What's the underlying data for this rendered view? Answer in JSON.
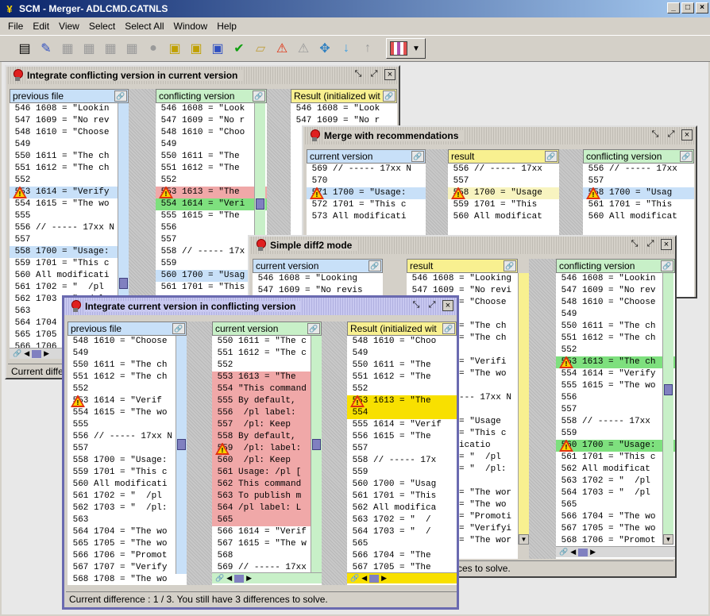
{
  "app": {
    "title": "SCM - Merger- ADLCMD.CATNLS"
  },
  "menu": [
    "File",
    "Edit",
    "View",
    "Select",
    "Select All",
    "Window",
    "Help"
  ],
  "status_text": "Current difference : 1 / 3. You still have 3 differences to solve.",
  "status_short1": "Current differe",
  "status_short2": "ces to solve.",
  "win1": {
    "title": "Integrate conflicting version in current version",
    "h1": "previous file",
    "h2": "conflicting version",
    "h3": "Result (initialized wit",
    "left": [
      [
        "546",
        "1608 = \"Lookin"
      ],
      [
        "547",
        "1609 = \"No rev"
      ],
      [
        "548",
        "1610 = \"Choose"
      ],
      [
        "549",
        ""
      ],
      [
        "550",
        "1611 = \"The ch"
      ],
      [
        "551",
        "1612 = \"The ch"
      ],
      [
        "552",
        ""
      ],
      [
        "553",
        "1614 = \"Verify"
      ],
      [
        "554",
        "1615 = \"The wo"
      ],
      [
        "555",
        ""
      ],
      [
        "556",
        "// ----- 17xx N"
      ],
      [
        "557",
        ""
      ],
      [
        "558",
        "1700 = \"Usage:"
      ],
      [
        "559",
        "1701 = \"This c"
      ],
      [
        "560",
        "All modificati"
      ],
      [
        "561",
        "1702 = \"  /pl"
      ],
      [
        "562",
        "1703 = \"  /pl"
      ],
      [
        "563",
        ""
      ],
      [
        "564",
        "1704"
      ],
      [
        "565",
        "1705"
      ],
      [
        "566",
        "1706"
      ]
    ],
    "mid": [
      [
        "546",
        "1608 = \"Look"
      ],
      [
        "547",
        "1609 = \"No r"
      ],
      [
        "548",
        "1610 = \"Choo"
      ],
      [
        "549",
        ""
      ],
      [
        "550",
        "1611 = \"The"
      ],
      [
        "551",
        "1612 = \"The"
      ],
      [
        "552",
        ""
      ],
      [
        "553",
        "1613 = \"The"
      ],
      [
        "554",
        "1614 = \"Veri"
      ],
      [
        "555",
        "1615 = \"The"
      ],
      [
        "556",
        ""
      ],
      [
        "557",
        ""
      ],
      [
        "558",
        "// ----- 17x"
      ],
      [
        "559",
        ""
      ],
      [
        "560",
        "1700 = \"Usag"
      ],
      [
        "561",
        "1701 = \"This"
      ]
    ],
    "right": [
      [
        "546",
        "1608 = \"Look"
      ],
      [
        "547",
        "1609 = \"No r"
      ]
    ]
  },
  "win2": {
    "title": "Merge with recommendations",
    "h1": "current version",
    "h2": "result",
    "h3": "conflicting version",
    "left": [
      [
        "569",
        "// ----- 17xx N"
      ],
      [
        "570",
        ""
      ],
      [
        "571",
        "1700 = \"Usage:"
      ],
      [
        "572",
        "1701 = \"This c"
      ],
      [
        "573",
        "All modificati"
      ]
    ],
    "mid": [
      [
        "556",
        "// ----- 17xx"
      ],
      [
        "557",
        ""
      ],
      [
        "558",
        "1700 = \"Usage"
      ],
      [
        "559",
        "1701 = \"This"
      ],
      [
        "560",
        "All modificat"
      ]
    ],
    "right": [
      [
        "556",
        "// ----- 17xx"
      ],
      [
        "557",
        ""
      ],
      [
        "558",
        "1700 = \"Usag"
      ],
      [
        "561",
        "1701 = \"This"
      ],
      [
        "560",
        "All modificat"
      ]
    ]
  },
  "win3": {
    "title": "Simple diff2 mode",
    "h1": "current version",
    "h2": "result",
    "h3": "conflicting version",
    "left": [
      [
        "546",
        "1608 = \"Looking"
      ],
      [
        "547",
        "1609 = \"No revis"
      ]
    ],
    "mid": [
      [
        "546",
        "1608 = \"Looking"
      ],
      [
        "547",
        "1609 = \"No revi"
      ],
      [
        "548",
        "1610 = \"Choose"
      ],
      [
        "549",
        ""
      ],
      [
        "550",
        "1611 = \"The ch"
      ],
      [
        "551",
        "1612 = \"The ch"
      ],
      [
        "552",
        ""
      ],
      [
        "553",
        "1614 = \"Verifi"
      ],
      [
        "554",
        "1615 = \"The wo"
      ],
      [
        "555",
        ""
      ],
      [
        "556",
        "// ----- 17xx N"
      ],
      [
        "557",
        ""
      ],
      [
        "558",
        "1700 = \"Usage"
      ],
      [
        "559",
        "1701 = \"This c"
      ],
      [
        "560",
        "modificatio"
      ],
      [
        "561",
        "1702 = \"  /pl"
      ],
      [
        "562",
        "1703 = \"  /pl:"
      ],
      [
        "563",
        ""
      ],
      [
        "564",
        "1704 = \"The wor"
      ],
      [
        "565",
        "1705 = \"The wo"
      ],
      [
        "566",
        "1706 = \"Promoti"
      ],
      [
        "567",
        "1707 = \"Verifyi"
      ],
      [
        "568",
        "1708 = \"The wor"
      ]
    ],
    "right": [
      [
        "546",
        "1608 = \"Lookin"
      ],
      [
        "547",
        "1609 = \"No rev"
      ],
      [
        "548",
        "1610 = \"Choose"
      ],
      [
        "549",
        ""
      ],
      [
        "550",
        "1611 = \"The ch"
      ],
      [
        "551",
        "1612 = \"The ch"
      ],
      [
        "552",
        ""
      ],
      [
        "553",
        "1613 = \"The ch"
      ],
      [
        "554",
        "1614 = \"Verify"
      ],
      [
        "555",
        "1615 = \"The wo"
      ],
      [
        "556",
        ""
      ],
      [
        "557",
        ""
      ],
      [
        "558",
        "// ----- 17xx"
      ],
      [
        "559",
        ""
      ],
      [
        "560",
        "1700 = \"Usage:"
      ],
      [
        "561",
        "1701 = \"This c"
      ],
      [
        "562",
        "All modificat"
      ],
      [
        "563",
        "1702 = \"  /pl"
      ],
      [
        "564",
        "1703 = \"  /pl"
      ],
      [
        "565",
        ""
      ],
      [
        "566",
        "1704 = \"The wo"
      ],
      [
        "567",
        "1705 = \"The wo"
      ],
      [
        "568",
        "1706 = \"Promot"
      ]
    ]
  },
  "win4": {
    "title": "Integrate current version in conflicting version",
    "h1": "previous file",
    "h2": "current version",
    "h3": "Result (initialized wit",
    "left": [
      [
        "548",
        "1610 = \"Choose"
      ],
      [
        "549",
        ""
      ],
      [
        "550",
        "1611 = \"The ch"
      ],
      [
        "551",
        "1612 = \"The ch"
      ],
      [
        "552",
        ""
      ],
      [
        "553",
        "1614 = \"Verif"
      ],
      [
        "554",
        "1615 = \"The wo"
      ],
      [
        "555",
        ""
      ],
      [
        "556",
        "// ----- 17xx N"
      ],
      [
        "557",
        ""
      ],
      [
        "558",
        "1700 = \"Usage:"
      ],
      [
        "559",
        "1701 = \"This c"
      ],
      [
        "560",
        "All modificati"
      ],
      [
        "561",
        "1702 = \"  /pl"
      ],
      [
        "562",
        "1703 = \"  /pl:"
      ],
      [
        "563",
        ""
      ],
      [
        "564",
        "1704 = \"The wo"
      ],
      [
        "565",
        "1705 = \"The wo"
      ],
      [
        "566",
        "1706 = \"Promot"
      ],
      [
        "567",
        "1707 = \"Verify"
      ],
      [
        "568",
        "1708 = \"The wo"
      ]
    ],
    "mid": [
      [
        "550",
        "1611 = \"The c"
      ],
      [
        "551",
        "1612 = \"The c"
      ],
      [
        "552",
        ""
      ],
      [
        "553",
        "1613 = \"The"
      ],
      [
        "554",
        "\"This command"
      ],
      [
        "555",
        "By default,"
      ],
      [
        "556",
        " /pl label:"
      ],
      [
        "557",
        " /pl: Keep"
      ],
      [
        "558",
        "By default,"
      ],
      [
        "559",
        " /pl: label:"
      ],
      [
        "560",
        " /pl: Keep"
      ],
      [
        "561",
        "Usage: /pl ["
      ],
      [
        "562",
        "This command"
      ],
      [
        "563",
        "To publish m"
      ],
      [
        "564",
        "/pl label: L"
      ],
      [
        "565",
        ""
      ],
      [
        "566",
        "1614 = \"Verif"
      ],
      [
        "567",
        "1615 = \"The w"
      ],
      [
        "568",
        ""
      ],
      [
        "569",
        "// ----- 17xx"
      ]
    ],
    "right": [
      [
        "548",
        "1610 = \"Choo"
      ],
      [
        "549",
        ""
      ],
      [
        "550",
        "1611 = \"The"
      ],
      [
        "551",
        "1612 = \"The"
      ],
      [
        "552",
        ""
      ],
      [
        "553",
        "1613 = \"The"
      ],
      [
        "554",
        ""
      ],
      [
        "555",
        "1614 = \"Verif"
      ],
      [
        "556",
        "1615 = \"The"
      ],
      [
        "557",
        ""
      ],
      [
        "558",
        "// ----- 17x"
      ],
      [
        "559",
        ""
      ],
      [
        "560",
        "1700 = \"Usag"
      ],
      [
        "561",
        "1701 = \"This"
      ],
      [
        "562",
        "All modifica"
      ],
      [
        "563",
        "1702 = \"  /"
      ],
      [
        "564",
        "1703 = \"  /"
      ],
      [
        "565",
        ""
      ],
      [
        "566",
        "1704 = \"The"
      ],
      [
        "567",
        "1705 = \"The"
      ],
      [
        "568",
        "1706 = \"Prom"
      ]
    ]
  },
  "extra": {
    "w1_result_cut": "1613 = \"The",
    "w3_result_cut": "---- 17xx N",
    "w3_line_cut": "\"The wor"
  }
}
